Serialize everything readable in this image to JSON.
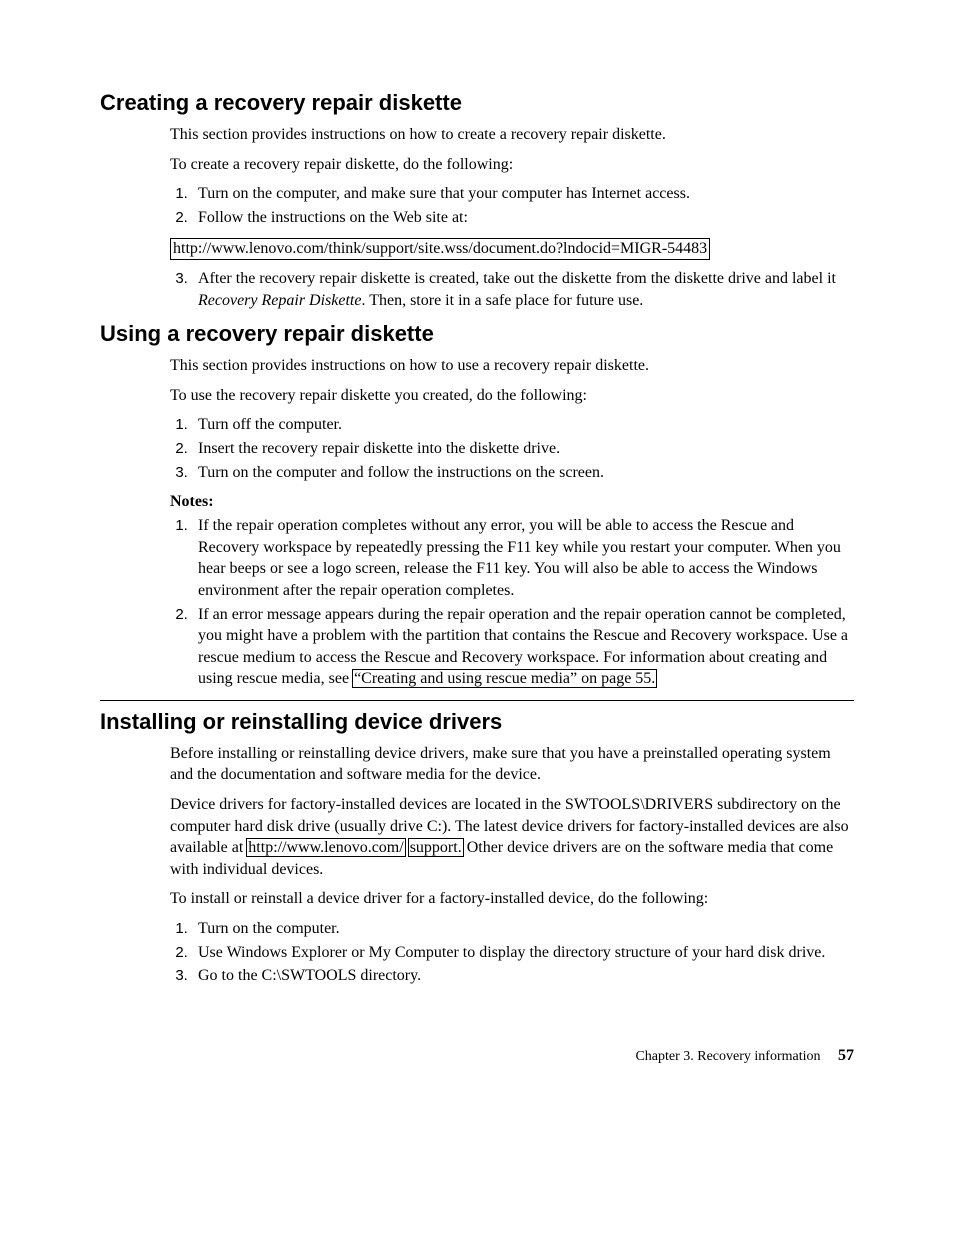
{
  "section1": {
    "heading": "Creating a recovery repair diskette",
    "intro": "This section provides instructions on how to create a recovery repair diskette.",
    "lead": "To create a recovery repair diskette, do the following:",
    "steps_a": [
      "Turn on the computer, and make sure that your computer has Internet access.",
      "Follow the instructions on the Web site at:"
    ],
    "url": "http://www.lenovo.com/think/support/site.wss/document.do?lndocid=MIGR-54483",
    "step3_pre": "After the recovery repair diskette is created, take out the diskette from the diskette drive and label it ",
    "step3_em": "Recovery Repair Diskette",
    "step3_post": ". Then, store it in a safe place for future use."
  },
  "section2": {
    "heading": "Using a recovery repair diskette",
    "intro": "This section provides instructions on how to use a recovery repair diskette.",
    "lead": "To use the recovery repair diskette you created, do the following:",
    "steps": [
      "Turn off the computer.",
      "Insert the recovery repair diskette into the diskette drive.",
      "Turn on the computer and follow the instructions on the screen."
    ],
    "notes_label": "Notes:",
    "notes": {
      "n1": "If the repair operation completes without any error, you will be able to access the Rescue and Recovery workspace by repeatedly pressing the F11 key while you restart your computer. When you hear beeps or see a logo screen, release the F11 key. You will also be able to access the Windows environment after the repair operation completes.",
      "n2_pre": "If an error message appears during the repair operation and the repair operation cannot be completed, you might have a problem with the partition that contains the Rescue and Recovery workspace. Use a rescue medium to access the Rescue and Recovery workspace. For information about creating and using rescue media, see ",
      "n2_link": "“Creating and using rescue media” on page 55."
    }
  },
  "section3": {
    "heading": "Installing or reinstalling device drivers",
    "p1": "Before installing or reinstalling device drivers, make sure that you have a preinstalled operating system and the documentation and software media for the device.",
    "p2_pre": "Device drivers for factory-installed devices are located in the SWTOOLS\\DRIVERS subdirectory on the computer hard disk drive (usually drive C:). The latest device drivers for factory-installed devices are also available at ",
    "p2_link1": "http://www.lenovo.com/",
    "p2_link2": "support.",
    "p2_post": " Other device drivers are on the software media that come with individual devices.",
    "lead": "To install or reinstall a device driver for a factory-installed device, do the following:",
    "steps": [
      "Turn on the computer.",
      "Use Windows Explorer or My Computer to display the directory structure of your hard disk drive.",
      "Go to the C:\\SWTOOLS directory."
    ]
  },
  "footer": {
    "chapter": "Chapter 3. Recovery information",
    "page": "57"
  }
}
